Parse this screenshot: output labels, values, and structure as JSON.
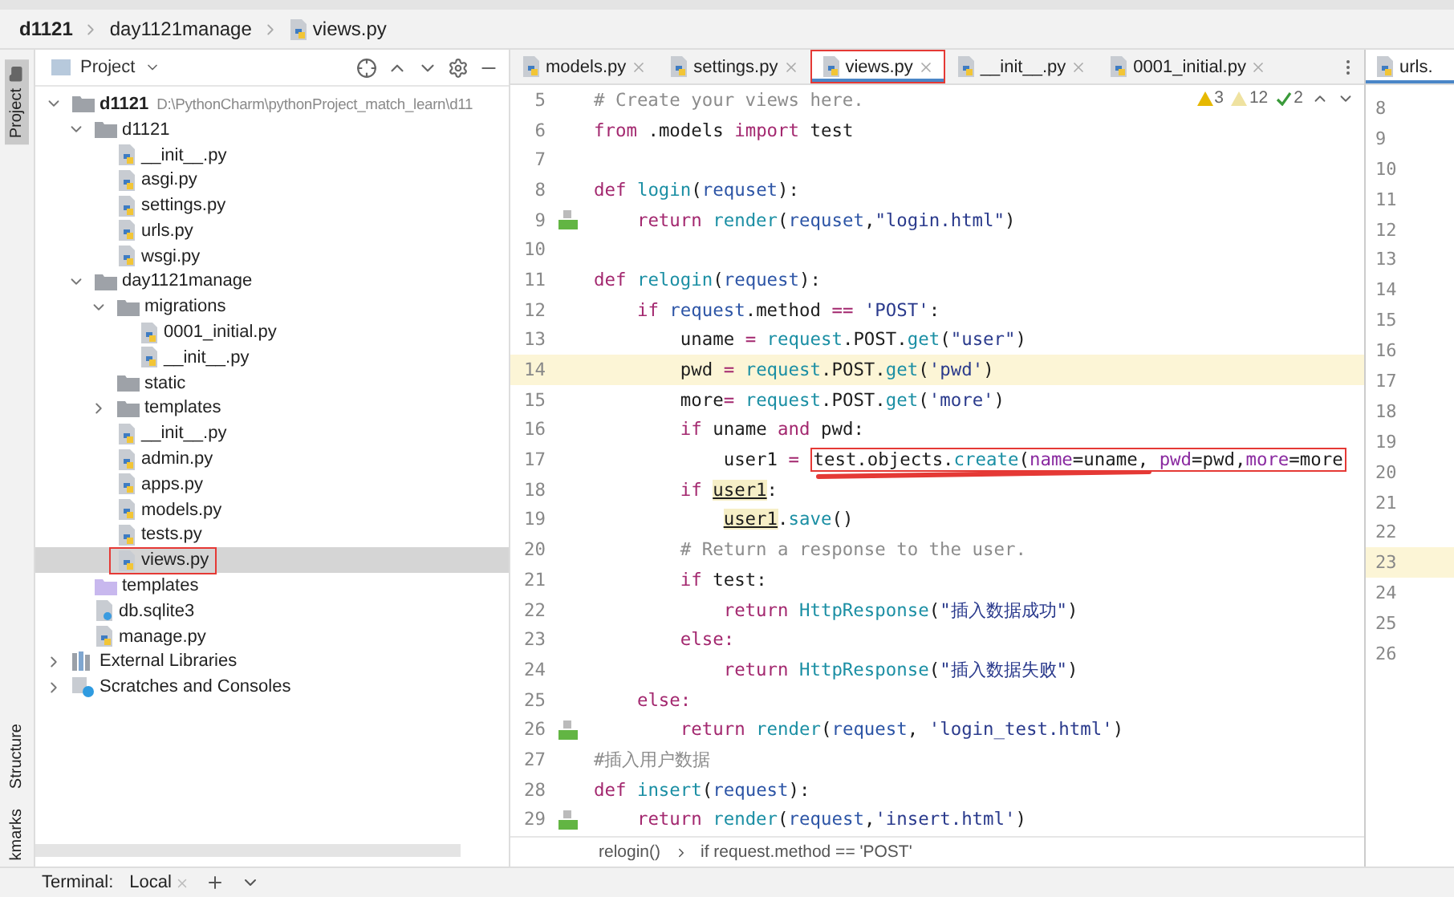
{
  "breadcrumb": [
    "d1121",
    "day1121manage",
    "views.py"
  ],
  "tool_strip": [
    {
      "label": "Project",
      "selected": true
    },
    {
      "label": "Structure",
      "selected": false
    },
    {
      "label": "kmarks",
      "selected": false
    }
  ],
  "project_panel": {
    "title": "Project",
    "tree": [
      {
        "name": "d1121",
        "kind": "folder",
        "bold": true,
        "path": "D:\\PythonCharm\\pythonProject_match_learn\\d11",
        "expanded": true,
        "selected": false,
        "annotated": false,
        "children": [
          {
            "name": "d1121",
            "kind": "folder",
            "expanded": true,
            "selected": false,
            "annotated": false,
            "children": [
              {
                "name": "__init__.py",
                "kind": "python",
                "selected": false,
                "annotated": false
              },
              {
                "name": "asgi.py",
                "kind": "python",
                "selected": false,
                "annotated": false
              },
              {
                "name": "settings.py",
                "kind": "python",
                "selected": false,
                "annotated": false
              },
              {
                "name": "urls.py",
                "kind": "python",
                "selected": false,
                "annotated": false
              },
              {
                "name": "wsgi.py",
                "kind": "python",
                "selected": false,
                "annotated": false
              }
            ]
          },
          {
            "name": "day1121manage",
            "kind": "folder",
            "expanded": true,
            "selected": false,
            "annotated": false,
            "children": [
              {
                "name": "migrations",
                "kind": "folder",
                "expanded": true,
                "selected": false,
                "annotated": false,
                "children": [
                  {
                    "name": "0001_initial.py",
                    "kind": "python",
                    "selected": false,
                    "annotated": false
                  },
                  {
                    "name": "__init__.py",
                    "kind": "python",
                    "selected": false,
                    "annotated": false
                  }
                ]
              },
              {
                "name": "static",
                "kind": "folder",
                "selected": false,
                "annotated": false
              },
              {
                "name": "templates",
                "kind": "folder",
                "expanded": false,
                "selected": false,
                "annotated": false
              },
              {
                "name": "__init__.py",
                "kind": "python",
                "selected": false,
                "annotated": false
              },
              {
                "name": "admin.py",
                "kind": "python",
                "selected": false,
                "annotated": false
              },
              {
                "name": "apps.py",
                "kind": "python",
                "selected": false,
                "annotated": false
              },
              {
                "name": "models.py",
                "kind": "python",
                "selected": false,
                "annotated": false
              },
              {
                "name": "tests.py",
                "kind": "python",
                "selected": false,
                "annotated": false
              },
              {
                "name": "views.py",
                "kind": "python",
                "selected": true,
                "annotated": true
              }
            ]
          },
          {
            "name": "templates",
            "kind": "template-folder",
            "selected": false,
            "annotated": false
          },
          {
            "name": "db.sqlite3",
            "kind": "file",
            "selected": false,
            "annotated": false
          },
          {
            "name": "manage.py",
            "kind": "python",
            "selected": false,
            "annotated": false
          }
        ]
      },
      {
        "name": "External Libraries",
        "kind": "libraries",
        "expanded": false,
        "selected": false,
        "annotated": false
      },
      {
        "name": "Scratches and Consoles",
        "kind": "scratches",
        "expanded": false,
        "selected": false,
        "annotated": false
      }
    ]
  },
  "editor_tabs": [
    {
      "label": "models.py",
      "selected": false,
      "annotated": false
    },
    {
      "label": "settings.py",
      "selected": false,
      "annotated": false
    },
    {
      "label": "views.py",
      "selected": true,
      "annotated": true
    },
    {
      "label": "__init__.py",
      "selected": false,
      "annotated": false
    },
    {
      "label": "0001_initial.py",
      "selected": false,
      "annotated": false
    }
  ],
  "inspections": {
    "warnings": "3",
    "weak_warnings": "12",
    "typos": "2"
  },
  "code_lines": [
    {
      "number": "5",
      "current": false,
      "gutter_icon": false,
      "scribble": false,
      "tokens": [
        {
          "kind": "cmt",
          "text": "# Create your views here."
        }
      ]
    },
    {
      "number": "6",
      "current": false,
      "gutter_icon": false,
      "scribble": false,
      "tokens": [
        {
          "kind": "kw",
          "text": "from"
        },
        {
          "kind": "plain",
          "text": " .models "
        },
        {
          "kind": "kw",
          "text": "import"
        },
        {
          "kind": "plain",
          "text": " test"
        }
      ]
    },
    {
      "number": "7",
      "current": false,
      "gutter_icon": false,
      "scribble": false
    },
    {
      "number": "8",
      "current": false,
      "gutter_icon": false,
      "scribble": false,
      "tokens": [
        {
          "kind": "kw",
          "text": "def "
        },
        {
          "kind": "fn",
          "text": "login"
        },
        {
          "kind": "plain",
          "text": "("
        },
        {
          "kind": "var",
          "text": "requset"
        },
        {
          "kind": "plain",
          "text": "):"
        }
      ]
    },
    {
      "number": "9",
      "current": false,
      "gutter_icon": true,
      "scribble": false,
      "tokens": [
        {
          "kind": "kw",
          "text": "    return "
        },
        {
          "kind": "fn",
          "text": "render"
        },
        {
          "kind": "plain",
          "text": "("
        },
        {
          "kind": "var",
          "text": "requset"
        },
        {
          "kind": "plain",
          "text": ","
        },
        {
          "kind": "str",
          "text": "\"login.html\""
        },
        {
          "kind": "plain",
          "text": ")"
        }
      ]
    },
    {
      "number": "10",
      "current": false,
      "gutter_icon": false,
      "scribble": false
    },
    {
      "number": "11",
      "current": false,
      "gutter_icon": false,
      "scribble": false,
      "tokens": [
        {
          "kind": "kw",
          "text": "def "
        },
        {
          "kind": "fn",
          "text": "relogin"
        },
        {
          "kind": "plain",
          "text": "("
        },
        {
          "kind": "var",
          "text": "request"
        },
        {
          "kind": "plain",
          "text": "):"
        }
      ]
    },
    {
      "number": "12",
      "current": false,
      "gutter_icon": false,
      "scribble": false,
      "tokens": [
        {
          "kind": "kw",
          "text": "    if "
        },
        {
          "kind": "var",
          "text": "request"
        },
        {
          "kind": "plain",
          "text": ".method "
        },
        {
          "kind": "kw",
          "text": "== "
        },
        {
          "kind": "str",
          "text": "'POST'"
        },
        {
          "kind": "plain",
          "text": ":"
        }
      ]
    },
    {
      "number": "13",
      "current": false,
      "gutter_icon": false,
      "scribble": false,
      "tokens": [
        {
          "kind": "plain",
          "text": "        uname "
        },
        {
          "kind": "kw",
          "text": "= "
        },
        {
          "kind": "fn",
          "text": "request"
        },
        {
          "kind": "plain",
          "text": ".POST."
        },
        {
          "kind": "fn",
          "text": "get"
        },
        {
          "kind": "plain",
          "text": "("
        },
        {
          "kind": "str",
          "text": "\"user\""
        },
        {
          "kind": "plain",
          "text": ")"
        }
      ]
    },
    {
      "number": "14",
      "current": true,
      "gutter_icon": false,
      "scribble": false,
      "tokens": [
        {
          "kind": "plain",
          "text": "        pwd "
        },
        {
          "kind": "kw",
          "text": "= "
        },
        {
          "kind": "fn",
          "text": "request"
        },
        {
          "kind": "plain",
          "text": ".POST."
        },
        {
          "kind": "fn",
          "text": "get"
        },
        {
          "kind": "plain",
          "text": "("
        },
        {
          "kind": "str",
          "text": "'pwd'"
        },
        {
          "kind": "plain",
          "text": ")"
        }
      ]
    },
    {
      "number": "15",
      "current": false,
      "gutter_icon": false,
      "scribble": false,
      "tokens": [
        {
          "kind": "plain",
          "text": "        more"
        },
        {
          "kind": "kw",
          "text": "= "
        },
        {
          "kind": "fn",
          "text": "request"
        },
        {
          "kind": "plain",
          "text": ".POST."
        },
        {
          "kind": "fn",
          "text": "get"
        },
        {
          "kind": "plain",
          "text": "("
        },
        {
          "kind": "str",
          "text": "'more'"
        },
        {
          "kind": "plain",
          "text": ")"
        }
      ]
    },
    {
      "number": "16",
      "current": false,
      "gutter_icon": false,
      "scribble": false,
      "tokens": [
        {
          "kind": "kw",
          "text": "        if"
        },
        {
          "kind": "plain",
          "text": " uname "
        },
        {
          "kind": "kw",
          "text": "and"
        },
        {
          "kind": "plain",
          "text": " pwd:"
        }
      ]
    },
    {
      "number": "17",
      "current": false,
      "gutter_icon": false,
      "scribble": true,
      "tokens": [
        {
          "kind": "plain",
          "text": "            user1 "
        },
        {
          "kind": "kw",
          "text": "= "
        }
      ],
      "boxed": [
        {
          "kind": "plain",
          "text": "test.objects."
        },
        {
          "kind": "fn",
          "text": "create"
        },
        {
          "kind": "plain",
          "text": "("
        },
        {
          "kind": "named",
          "text": "name"
        },
        {
          "kind": "plain",
          "text": "=uname, "
        },
        {
          "kind": "named",
          "text": "pwd"
        },
        {
          "kind": "plain",
          "text": "=pwd,"
        },
        {
          "kind": "named",
          "text": "more"
        },
        {
          "kind": "plain",
          "text": "=more"
        }
      ]
    },
    {
      "number": "18",
      "current": false,
      "gutter_icon": false,
      "scribble": false,
      "tokens": [
        {
          "kind": "kw",
          "text": "        if "
        },
        {
          "kind": "ref",
          "text": "user1"
        },
        {
          "kind": "plain",
          "text": ":"
        }
      ]
    },
    {
      "number": "19",
      "current": false,
      "gutter_icon": false,
      "scribble": false,
      "tokens": [
        {
          "kind": "ref",
          "text": "            user1"
        },
        {
          "kind": "plain",
          "text": "."
        },
        {
          "kind": "fn",
          "text": "save"
        },
        {
          "kind": "plain",
          "text": "()"
        }
      ]
    },
    {
      "number": "20",
      "current": false,
      "gutter_icon": false,
      "scribble": false,
      "tokens": [
        {
          "kind": "cmt",
          "text": "        # Return a response to the user."
        }
      ]
    },
    {
      "number": "21",
      "current": false,
      "gutter_icon": false,
      "scribble": false,
      "tokens": [
        {
          "kind": "kw",
          "text": "        if"
        },
        {
          "kind": "plain",
          "text": " test:"
        }
      ]
    },
    {
      "number": "22",
      "current": false,
      "gutter_icon": false,
      "scribble": false,
      "tokens": [
        {
          "kind": "kw",
          "text": "            return "
        },
        {
          "kind": "fn",
          "text": "HttpResponse"
        },
        {
          "kind": "plain",
          "text": "("
        },
        {
          "kind": "str",
          "text": "\"插入数据成功\""
        },
        {
          "kind": "plain",
          "text": ")"
        }
      ]
    },
    {
      "number": "23",
      "current": false,
      "gutter_icon": false,
      "scribble": false,
      "tokens": [
        {
          "kind": "kw",
          "text": "        else:"
        }
      ]
    },
    {
      "number": "24",
      "current": false,
      "gutter_icon": false,
      "scribble": false,
      "tokens": [
        {
          "kind": "kw",
          "text": "            return "
        },
        {
          "kind": "fn",
          "text": "HttpResponse"
        },
        {
          "kind": "plain",
          "text": "("
        },
        {
          "kind": "str",
          "text": "\"插入数据失败\""
        },
        {
          "kind": "plain",
          "text": ")"
        }
      ]
    },
    {
      "number": "25",
      "current": false,
      "gutter_icon": false,
      "scribble": false,
      "tokens": [
        {
          "kind": "kw",
          "text": "    else:"
        }
      ]
    },
    {
      "number": "26",
      "current": false,
      "gutter_icon": true,
      "scribble": false,
      "tokens": [
        {
          "kind": "kw",
          "text": "        return "
        },
        {
          "kind": "fn",
          "text": "render"
        },
        {
          "kind": "plain",
          "text": "("
        },
        {
          "kind": "var",
          "text": "request"
        },
        {
          "kind": "plain",
          "text": ", "
        },
        {
          "kind": "str",
          "text": "'login_test.html'"
        },
        {
          "kind": "plain",
          "text": ")"
        }
      ]
    },
    {
      "number": "27",
      "current": false,
      "gutter_icon": false,
      "scribble": false,
      "tokens": [
        {
          "kind": "cmt",
          "text": "#插入用户数据"
        }
      ]
    },
    {
      "number": "28",
      "current": false,
      "gutter_icon": false,
      "scribble": false,
      "tokens": [
        {
          "kind": "kw",
          "text": "def "
        },
        {
          "kind": "fn",
          "text": "insert"
        },
        {
          "kind": "plain",
          "text": "("
        },
        {
          "kind": "var",
          "text": "request"
        },
        {
          "kind": "plain",
          "text": "):"
        }
      ]
    },
    {
      "number": "29",
      "current": false,
      "gutter_icon": true,
      "scribble": false,
      "tokens": [
        {
          "kind": "kw",
          "text": "    return "
        },
        {
          "kind": "fn",
          "text": "render"
        },
        {
          "kind": "plain",
          "text": "("
        },
        {
          "kind": "var",
          "text": "request"
        },
        {
          "kind": "plain",
          "text": ","
        },
        {
          "kind": "str",
          "text": "'insert.html'"
        },
        {
          "kind": "plain",
          "text": ")"
        }
      ]
    }
  ],
  "code_breadcrumb": [
    "relogin()",
    "if request.method == 'POST'"
  ],
  "split_editor": {
    "tab": "urls.",
    "lines": [
      {
        "number": "8",
        "current": false
      },
      {
        "number": "9",
        "current": false
      },
      {
        "number": "10",
        "current": false
      },
      {
        "number": "11",
        "current": false
      },
      {
        "number": "12",
        "current": false
      },
      {
        "number": "13",
        "current": false
      },
      {
        "number": "14",
        "current": false
      },
      {
        "number": "15",
        "current": false
      },
      {
        "number": "16",
        "current": false
      },
      {
        "number": "17",
        "current": false
      },
      {
        "number": "18",
        "current": false
      },
      {
        "number": "19",
        "current": false
      },
      {
        "number": "20",
        "current": false
      },
      {
        "number": "21",
        "current": false
      },
      {
        "number": "22",
        "current": false
      },
      {
        "number": "23",
        "current": true
      },
      {
        "number": "24",
        "current": false
      },
      {
        "number": "25",
        "current": false
      },
      {
        "number": "26",
        "current": false
      }
    ]
  },
  "terminal_bar": {
    "title": "Terminal:",
    "tab": "Local"
  }
}
